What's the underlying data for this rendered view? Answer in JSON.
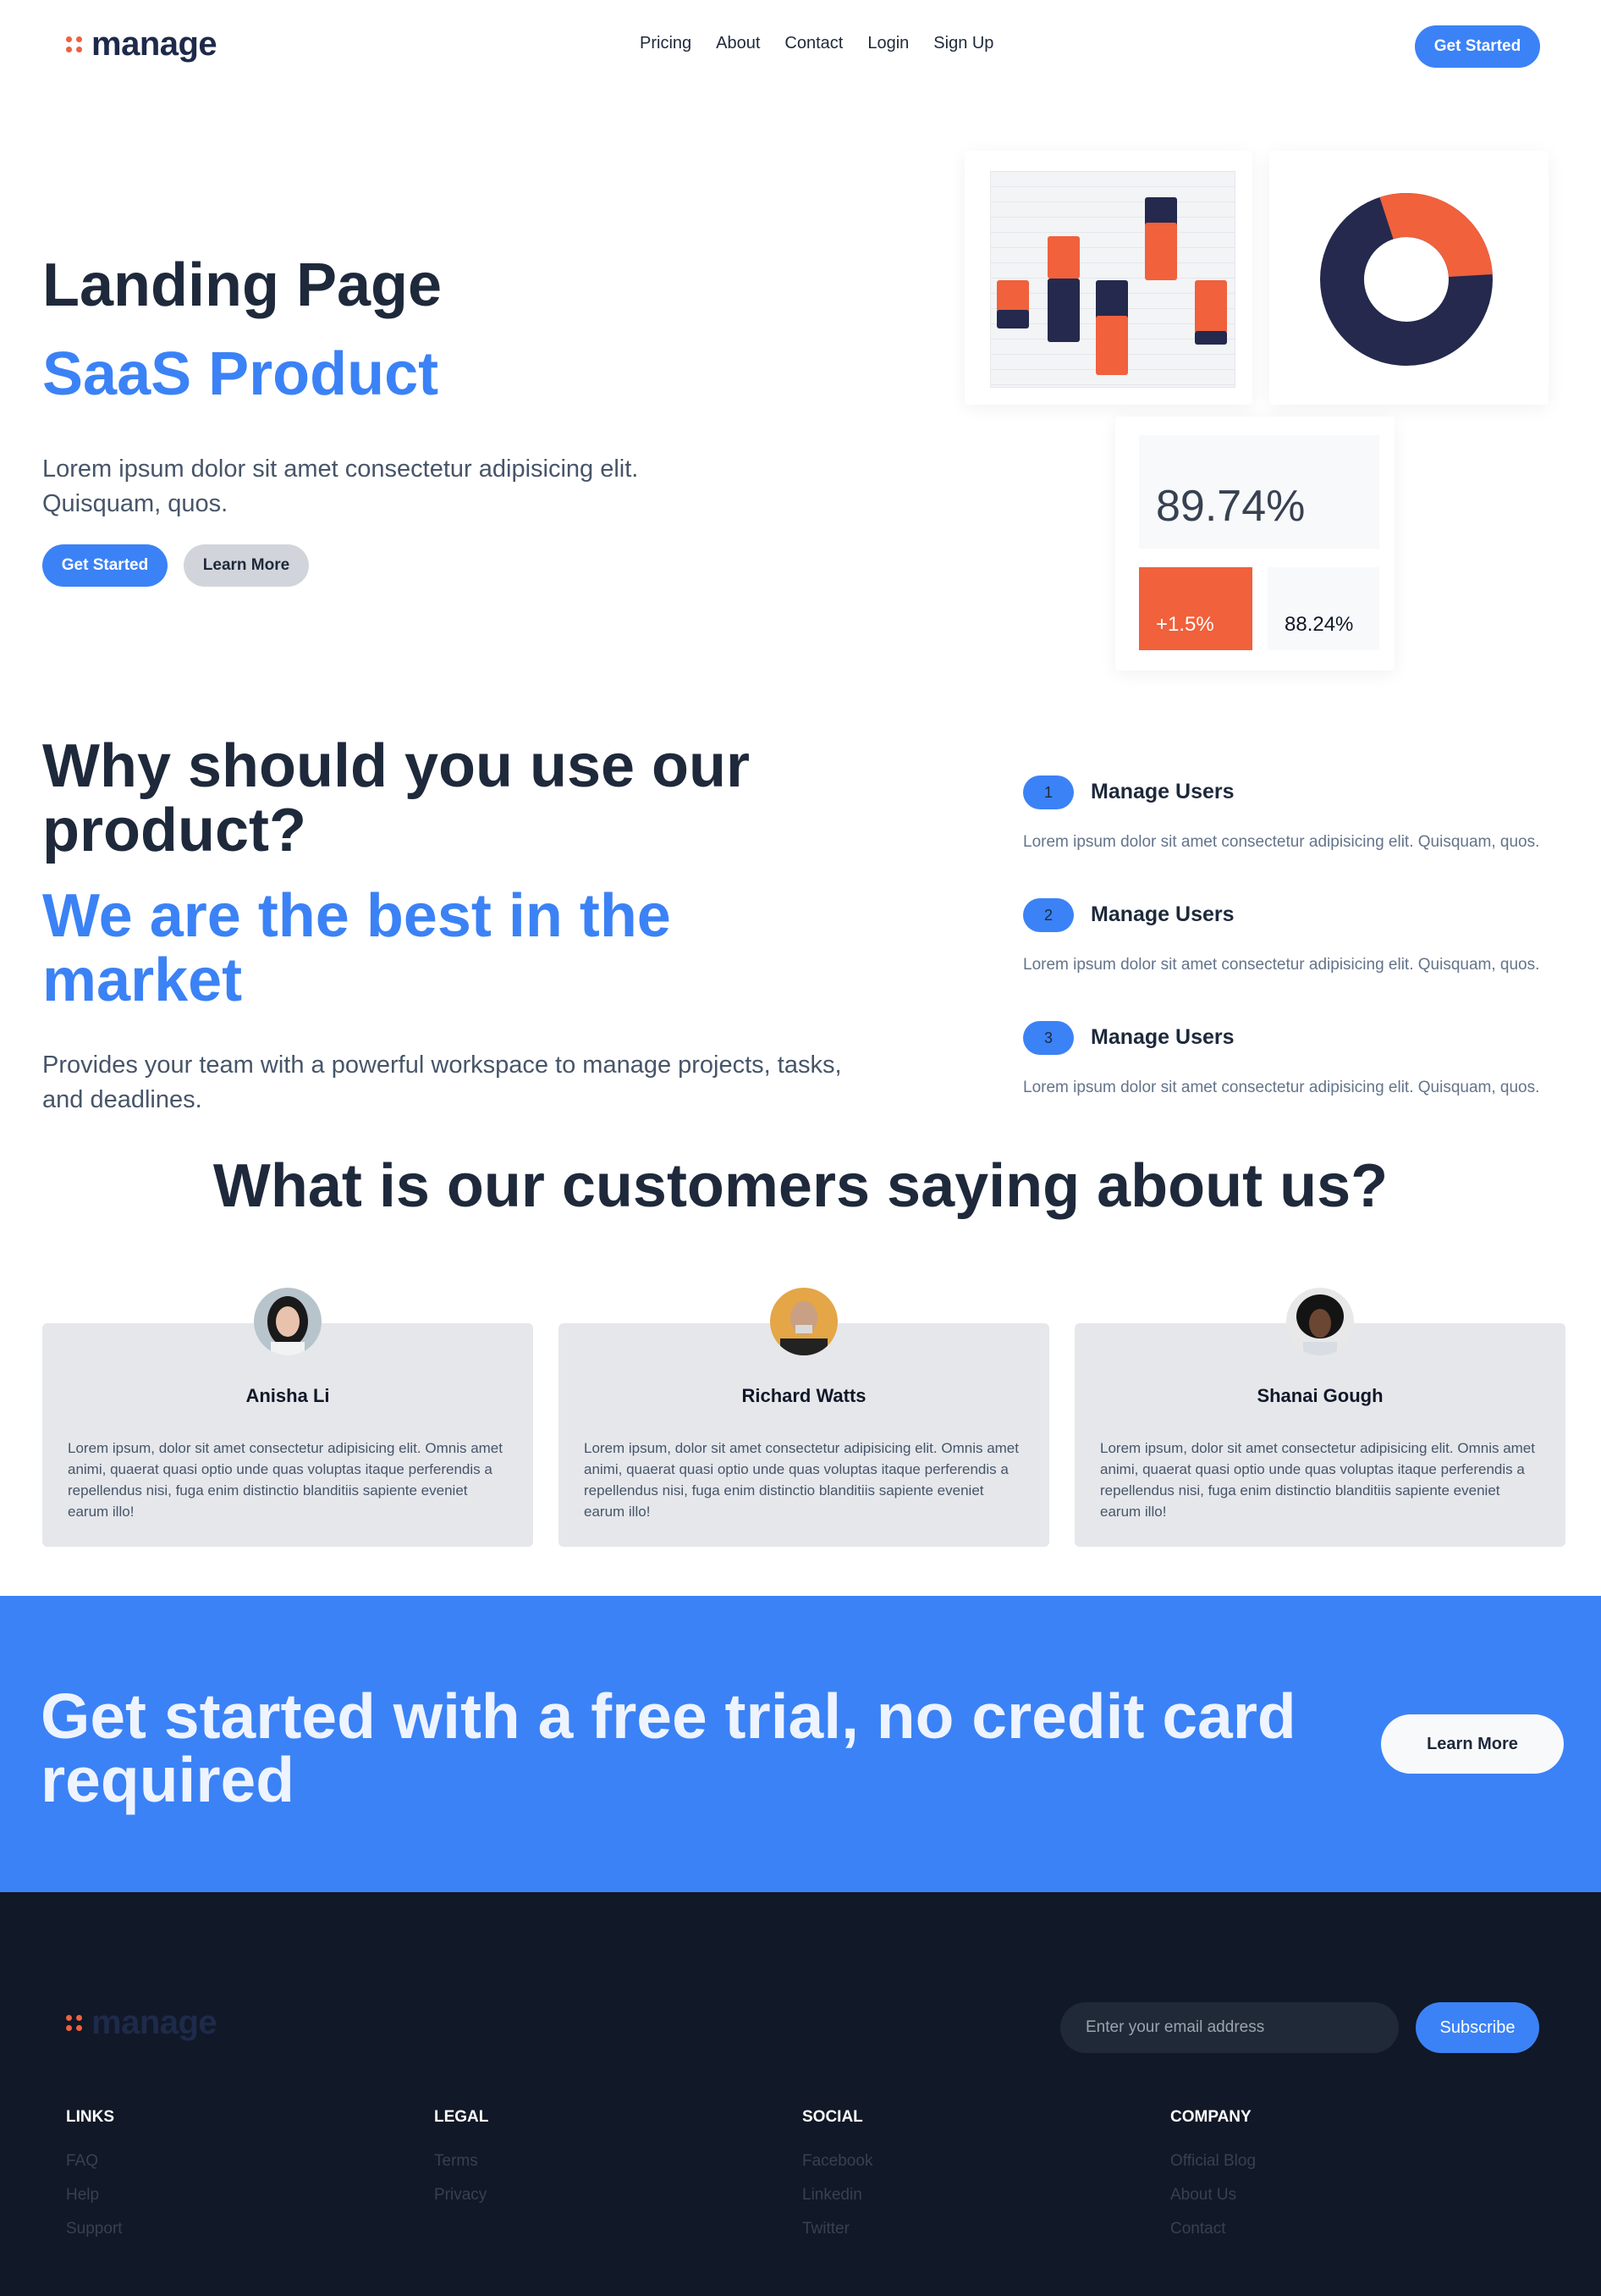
{
  "nav": {
    "logo_text": "manage",
    "links": [
      "Pricing",
      "About",
      "Contact",
      "Login",
      "Sign Up"
    ],
    "cta_label": "Get Started"
  },
  "hero": {
    "title": "Landing Page",
    "subtitle": "SaaS Product",
    "description": "Lorem ipsum dolor sit amet consectetur adipisicing elit. Quisquam, quos.",
    "primary_button": "Get Started",
    "secondary_button": "Learn More"
  },
  "stats": {
    "main_value": "89.74%",
    "change_value": "+1.5%",
    "secondary_value": "88.24%"
  },
  "colors": {
    "primary": "#3b82f6",
    "accent": "#f0613c",
    "navy": "#24294d"
  },
  "why": {
    "title": "Why should you use our product?",
    "subtitle": "We are the best in the market",
    "description": "Provides your team with a powerful workspace to manage projects, tasks, and deadlines.",
    "features": [
      {
        "number": "1",
        "title": "Manage Users",
        "description": "Lorem ipsum dolor sit amet consectetur adipisicing elit. Quisquam, quos."
      },
      {
        "number": "2",
        "title": "Manage Users",
        "description": "Lorem ipsum dolor sit amet consectetur adipisicing elit. Quisquam, quos."
      },
      {
        "number": "3",
        "title": "Manage Users",
        "description": "Lorem ipsum dolor sit amet consectetur adipisicing elit. Quisquam, quos."
      }
    ]
  },
  "testimonials": {
    "title": "What is our customers saying about us?",
    "items": [
      {
        "name": "Anisha Li",
        "text": "Lorem ipsum, dolor sit amet consectetur adipisicing elit. Omnis amet animi, quaerat quasi optio unde quas voluptas itaque perferendis a repellendus nisi, fuga enim distinctio blanditiis sapiente eveniet earum illo!"
      },
      {
        "name": "Richard Watts",
        "text": "Lorem ipsum, dolor sit amet consectetur adipisicing elit. Omnis amet animi, quaerat quasi optio unde quas voluptas itaque perferendis a repellendus nisi, fuga enim distinctio blanditiis sapiente eveniet earum illo!"
      },
      {
        "name": "Shanai Gough",
        "text": "Lorem ipsum, dolor sit amet consectetur adipisicing elit. Omnis amet animi, quaerat quasi optio unde quas voluptas itaque perferendis a repellendus nisi, fuga enim distinctio blanditiis sapiente eveniet earum illo!"
      }
    ]
  },
  "cta": {
    "text": "Get started with a free trial, no credit card required",
    "button": "Learn More"
  },
  "footer": {
    "logo_text": "manage",
    "email_placeholder": "Enter your email address",
    "subscribe_label": "Subscribe",
    "columns": [
      {
        "heading": "LINKS",
        "links": [
          "FAQ",
          "Help",
          "Support"
        ]
      },
      {
        "heading": "LEGAL",
        "links": [
          "Terms",
          "Privacy"
        ]
      },
      {
        "heading": "SOCIAL",
        "links": [
          "Facebook",
          "Linkedin",
          "Twitter"
        ]
      },
      {
        "heading": "COMPANY",
        "links": [
          "Official Blog",
          "About Us",
          "Contact"
        ]
      }
    ]
  }
}
